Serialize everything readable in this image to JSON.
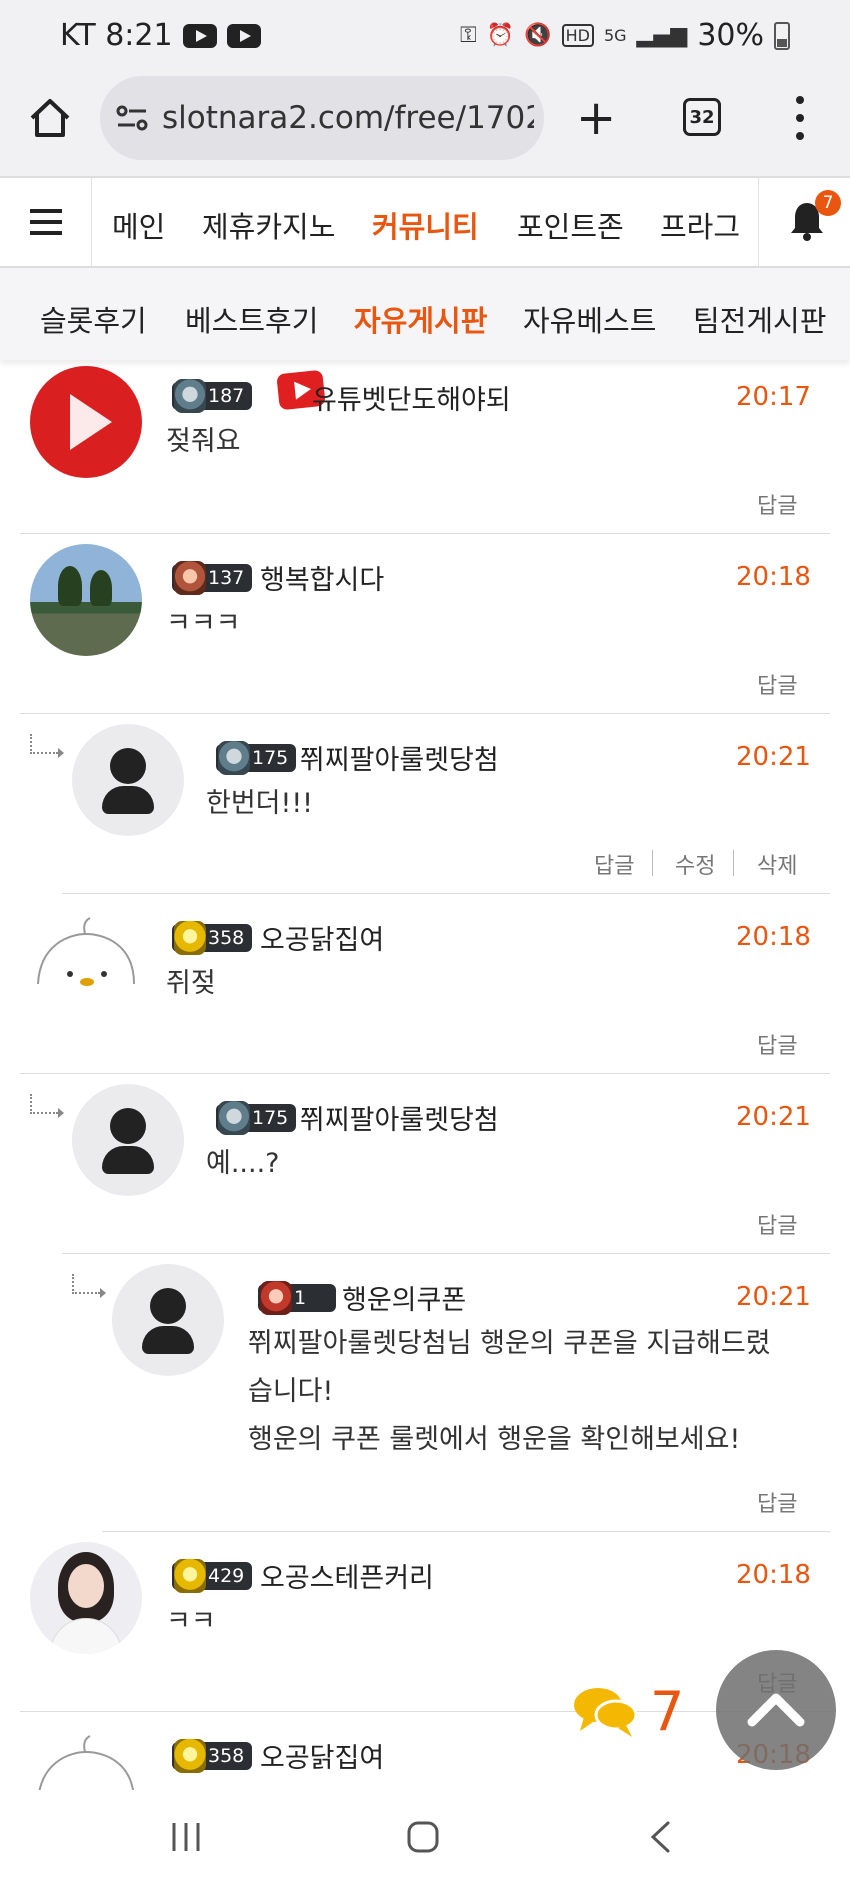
{
  "status_bar": {
    "carrier_time": "KT 8:21",
    "battery": "30%",
    "network": "5G"
  },
  "browser": {
    "url": "slotnara2.com/free/1702",
    "tab_count": "32"
  },
  "site_nav": {
    "items": [
      "메인",
      "제휴카지노",
      "커뮤니티",
      "포인트존",
      "프라그"
    ],
    "active": "커뮤니티",
    "notification_count": "7"
  },
  "sub_nav": {
    "items": [
      "슬롯후기",
      "베스트후기",
      "자유게시판",
      "자유베스트",
      "팀전게시판"
    ],
    "active": "자유게시판"
  },
  "comments": [
    {
      "level": "187",
      "nickname": "유튜벳단도해야되",
      "time": "20:17",
      "text": "젖줘요",
      "actions": [
        "답글"
      ]
    },
    {
      "level": "137",
      "nickname": "행복합시다",
      "time": "20:18",
      "text": "ㅋㅋㅋ",
      "actions": [
        "답글"
      ]
    },
    {
      "level": "175",
      "nickname": "쮜찌팔아룰렛당첨",
      "time": "20:21",
      "text": "한번더!!!",
      "actions": [
        "답글",
        "수정",
        "삭제"
      ]
    },
    {
      "level": "358",
      "nickname": "오공닭집여",
      "time": "20:18",
      "text": "쥐젖",
      "actions": [
        "답글"
      ]
    },
    {
      "level": "175",
      "nickname": "쮜찌팔아룰렛당첨",
      "time": "20:21",
      "text": "예....?",
      "actions": [
        "답글"
      ]
    },
    {
      "level": "1",
      "nickname": "행운의쿠폰",
      "time": "20:21",
      "text_lines": [
        "쮜찌팔아룰렛당첨님 행운의 쿠폰을 지급해드렸",
        "습니다!",
        "행운의 쿠폰 룰렛에서 행운을 확인해보세요!"
      ],
      "actions": [
        "답글"
      ]
    },
    {
      "level": "429",
      "nickname": "오공스테픈커리",
      "time": "20:18",
      "text": "ㅋㅋ",
      "actions": [
        "답글"
      ]
    },
    {
      "level": "358",
      "nickname": "오공닭집여",
      "time": "20:18"
    }
  ],
  "floating": {
    "comment_count": "7"
  },
  "colors": {
    "accent": "#e9560f",
    "time": "#e9560f",
    "badge_bg": "#2b2e33"
  },
  "icons": [
    "home-icon",
    "site-settings-icon",
    "plus-icon",
    "tabs-icon",
    "more-icon",
    "menu-icon",
    "bell-icon",
    "reply-arrow-icon",
    "comment-bubble-icon",
    "chevron-up-icon"
  ]
}
